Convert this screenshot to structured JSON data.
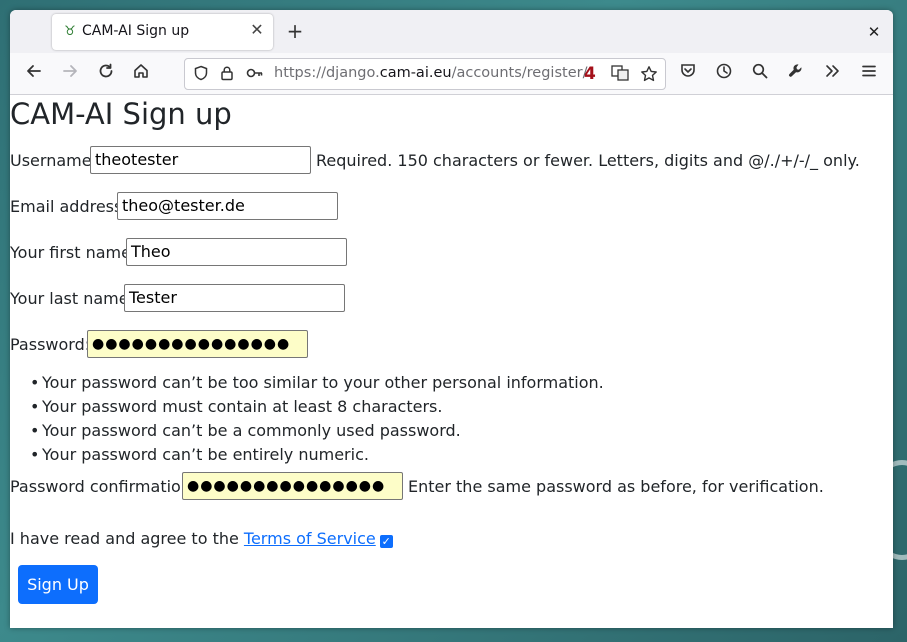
{
  "browser": {
    "tab_title": "CAM-AI Sign up",
    "new_tab_label": "+",
    "url_scheme_path_prefix": "https://django.",
    "url_host": "cam-ai.eu",
    "url_path": "/accounts/register/",
    "url_badge": "4",
    "icons": {
      "back": "arrow-left-icon",
      "forward": "arrow-right-icon",
      "reload": "reload-icon",
      "home": "home-icon",
      "shield": "shield-icon",
      "lock": "lock-icon",
      "key": "key-icon",
      "translate": "translate-icon",
      "bookmark": "star-icon",
      "pocket": "save-to-pocket-icon",
      "history": "history-icon",
      "search": "search-icon",
      "tools": "wrench-icon",
      "overflow": "chevrons-right-icon",
      "menu": "hamburger-menu-icon",
      "close_window": "close-icon"
    }
  },
  "page": {
    "title": "CAM-AI Sign up",
    "username": {
      "label": "Username:",
      "value": "theotester",
      "help": "Required. 150 characters or fewer. Letters, digits and @/./+/-/_ only."
    },
    "email": {
      "label": "Email address:",
      "value": "theo@tester.de"
    },
    "first_name": {
      "label": "Your first name:",
      "value": "Theo"
    },
    "last_name": {
      "label": "Your last name:",
      "value": "Tester"
    },
    "password": {
      "label": "Password:",
      "masked_value": "●●●●●●●●●●●●●●●",
      "rules": [
        "Your password can’t be too similar to your other personal information.",
        "Your password must contain at least 8 characters.",
        "Your password can’t be a commonly used password.",
        "Your password can’t be entirely numeric."
      ]
    },
    "password_confirmation": {
      "label": "Password confirmation:",
      "masked_value": "●●●●●●●●●●●●●●●",
      "help": "Enter the same password as before, for verification."
    },
    "terms": {
      "prefix": "I have read and agree to the ",
      "link_text": "Terms of Service",
      "checked": true
    },
    "submit_label": "Sign Up"
  },
  "colors": {
    "accent": "#0d6efd",
    "autofill": "#fdfdc8",
    "url_badge": "#a4101a"
  }
}
